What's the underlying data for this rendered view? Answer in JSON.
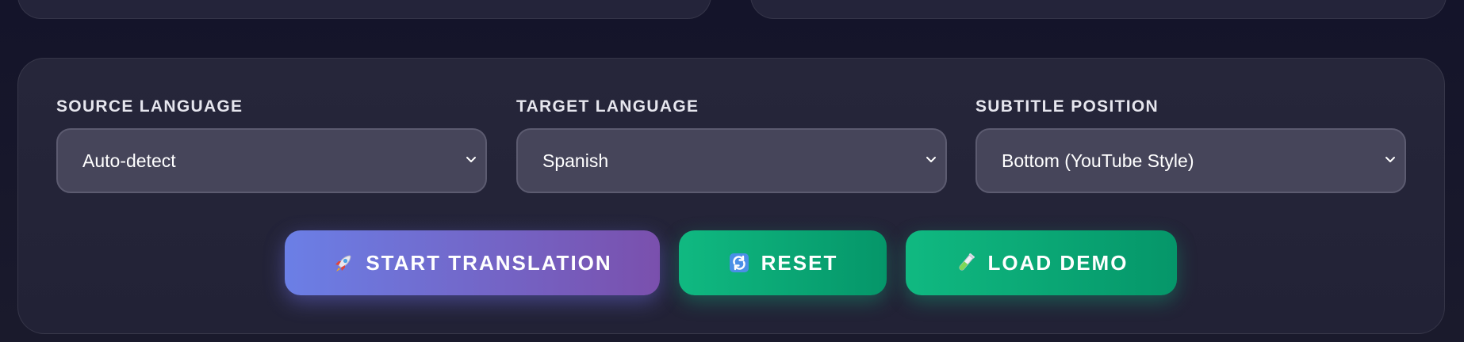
{
  "settings": {
    "source_language": {
      "label": "SOURCE LANGUAGE",
      "selected": "Auto-detect"
    },
    "target_language": {
      "label": "TARGET LANGUAGE",
      "selected": "Spanish"
    },
    "subtitle_position": {
      "label": "SUBTITLE POSITION",
      "selected": "Bottom (YouTube Style)"
    }
  },
  "actions": {
    "start": {
      "label": "START TRANSLATION",
      "icon": "rocket-icon"
    },
    "reset": {
      "label": "RESET",
      "icon": "refresh-icon"
    },
    "demo": {
      "label": "LOAD DEMO",
      "icon": "test-tube-icon"
    }
  },
  "colors": {
    "background": "#16162a",
    "panel": "#24243a",
    "select_bg": "#46455a",
    "start_gradient": [
      "#6b7fe6",
      "#7a50ad"
    ],
    "green_gradient": [
      "#10b981",
      "#059669"
    ]
  }
}
